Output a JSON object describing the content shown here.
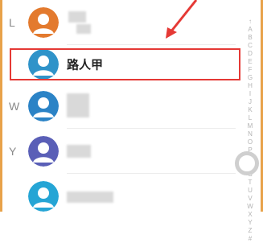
{
  "contacts": [
    {
      "section": "L",
      "name": "",
      "avatar_color": "#e37a2e"
    },
    {
      "section": "",
      "name": "路人甲",
      "avatar_color": "#2f93c9"
    },
    {
      "section": "W",
      "name": "",
      "avatar_color": "#2b83c6"
    },
    {
      "section": "Y",
      "name": "",
      "avatar_color": "#5a5fb7"
    },
    {
      "section": "",
      "name": "",
      "avatar_color": "#25a5d5"
    }
  ],
  "index_letters": [
    "↑",
    "A",
    "B",
    "C",
    "D",
    "E",
    "F",
    "G",
    "H",
    "I",
    "J",
    "K",
    "L",
    "M",
    "N",
    "O",
    "P",
    "Q",
    "R",
    "S",
    "T",
    "U",
    "V",
    "W",
    "X",
    "Y",
    "Z",
    "#"
  ],
  "colors": {
    "highlight": "#e53935",
    "arrow": "#e53935",
    "frame": "#e8a24a"
  }
}
